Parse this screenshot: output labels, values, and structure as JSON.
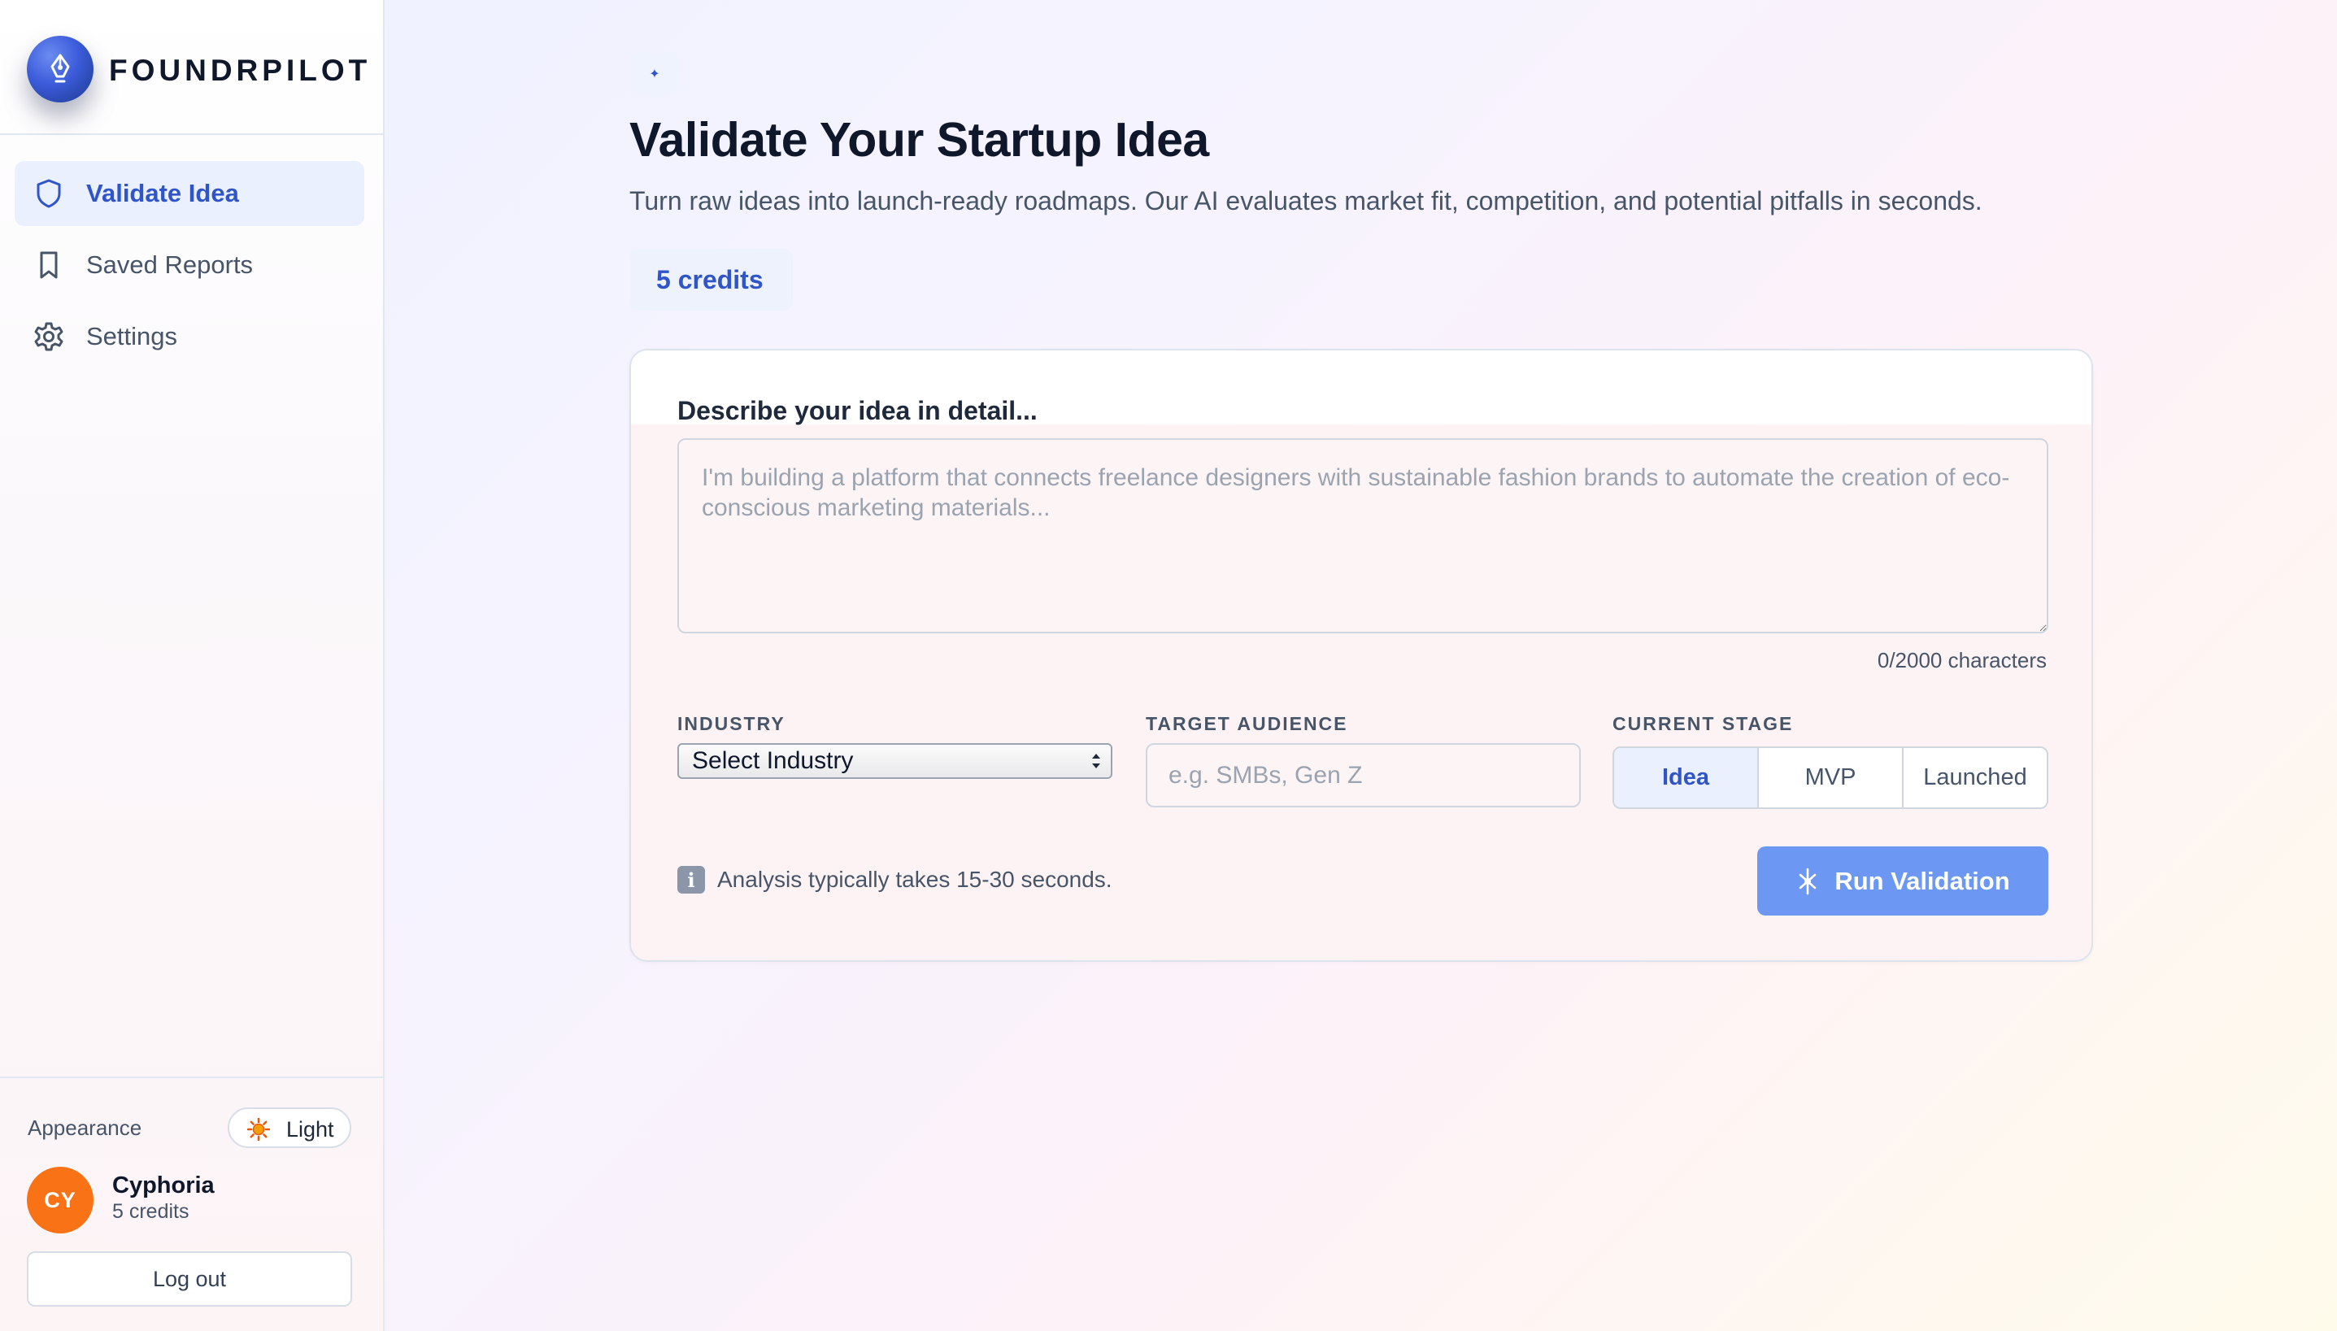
{
  "brand": {
    "name": "FOUNDRPILOT",
    "logo_icon": "pen-nib-icon",
    "accent": "#2f55c9"
  },
  "sidebar": {
    "items": [
      {
        "label": "Validate Idea",
        "icon": "shield-icon",
        "active": true
      },
      {
        "label": "Saved Reports",
        "icon": "bookmark-icon",
        "active": false
      },
      {
        "label": "Settings",
        "icon": "gear-icon",
        "active": false
      }
    ],
    "appearance_label": "Appearance",
    "theme": {
      "label": "Light",
      "icon": "sun-icon"
    },
    "user": {
      "initials": "CY",
      "name": "Cyphoria",
      "credits": "5 credits",
      "avatar_color": "#f97316"
    },
    "logout_label": "Log out"
  },
  "main": {
    "badge_icon": "sparkle-icon",
    "title": "Validate Your Startup Idea",
    "subtitle": "Turn raw ideas into launch-ready roadmaps. Our AI evaluates market fit, competition, and potential pitfalls in seconds.",
    "credits": "5 credits",
    "form": {
      "description_label": "Describe your idea in detail...",
      "description_value": "",
      "description_placeholder": "I'm building a platform that connects freelance designers with sustainable fashion brands to automate the creation of eco-conscious marketing materials...",
      "char_count": "0/2000 characters",
      "industry_label": "INDUSTRY",
      "industry_selected": "Select Industry",
      "audience_label": "TARGET AUDIENCE",
      "audience_value": "",
      "audience_placeholder": "e.g. SMBs, Gen Z",
      "stage_label": "CURRENT STAGE",
      "stages": [
        {
          "label": "Idea",
          "active": true
        },
        {
          "label": "MVP",
          "active": false
        },
        {
          "label": "Launched",
          "active": false
        }
      ],
      "info_icon": "info-icon",
      "info_text": "Analysis typically takes 15-30 seconds.",
      "submit_label": "Run Validation",
      "submit_icon": "sparkle-icon",
      "submit_color": "#6c98f3"
    }
  }
}
